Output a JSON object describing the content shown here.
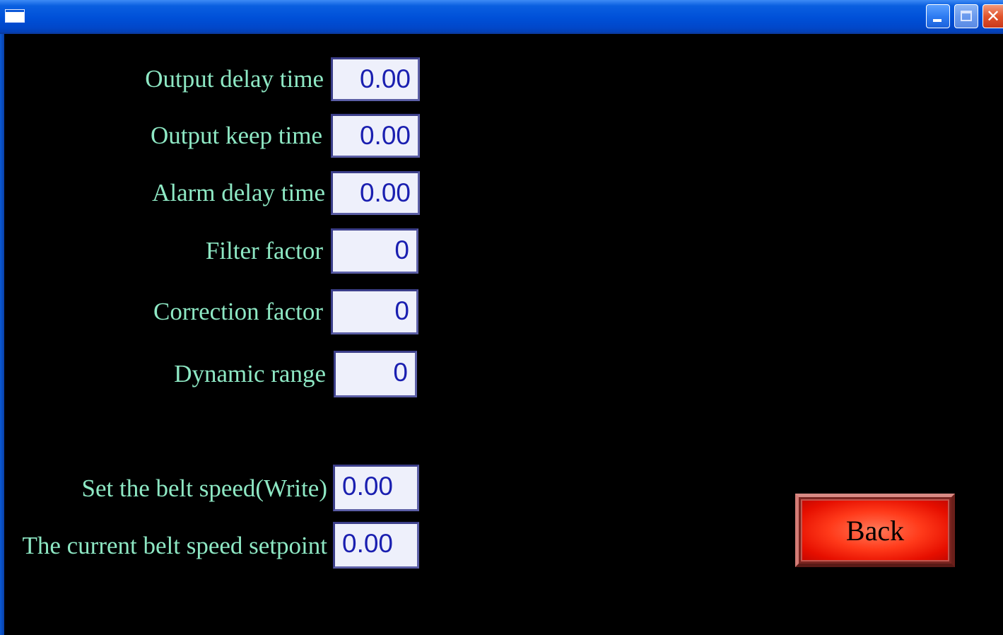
{
  "window": {
    "title": "",
    "controls": {
      "minimize_icon": "minimize-icon",
      "maximize_icon": "maximize-icon",
      "close_icon": "close-icon",
      "close_glyph": "✕"
    }
  },
  "params": [
    {
      "label": "Output delay time",
      "value": "0.00"
    },
    {
      "label": "Output keep time",
      "value": "0.00"
    },
    {
      "label": "Alarm delay time",
      "value": "0.00"
    },
    {
      "label": "Filter factor",
      "value": "0"
    },
    {
      "label": "Correction factor",
      "value": "0"
    },
    {
      "label": "Dynamic range",
      "value": "0"
    }
  ],
  "belt": {
    "set_label": "Set the belt speed(Write)",
    "set_value": "0.00",
    "current_label": "The current belt speed setpoint",
    "current_value": "0.00"
  },
  "back_button": {
    "label": "Back"
  },
  "colors": {
    "background": "#000000",
    "label_text": "#8ee8c4",
    "field_text": "#1a1fb0",
    "field_bg": "#eef0fb",
    "back_button": "#ff3a1a"
  }
}
